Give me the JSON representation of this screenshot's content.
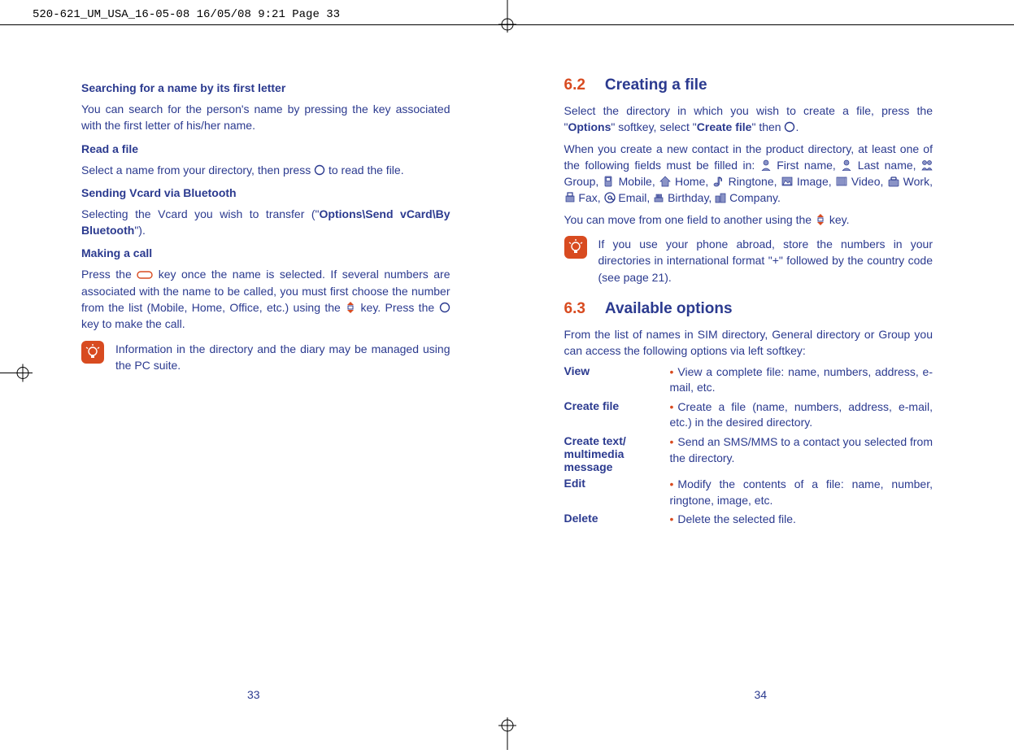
{
  "print_header": "520-621_UM_USA_16-05-08  16/05/08  9:21  Page 33",
  "left": {
    "h_search": "Searching for a name by its first letter",
    "p_search": "You can search for the person's name by pressing the key associated with the first letter of his/her name.",
    "h_read": "Read a file",
    "p_read_a": "Select a name from your directory, then press ",
    "p_read_b": " to read the file.",
    "h_send": "Sending Vcard via Bluetooth",
    "p_send_a": "Selecting the Vcard you wish to transfer (\"",
    "p_send_b": "Options\\Send vCard\\By Bluetooth",
    "p_send_c": "\").",
    "h_call": "Making a call",
    "p_call_a": "Press the ",
    "p_call_b": " key once the name is selected. If several numbers are associated with the name to be called, you must first choose the number from the list (Mobile, Home, Office, etc.) using the ",
    "p_call_c": " key. Press the ",
    "p_call_d": " key to make the call.",
    "tip": "Information in the directory and the diary may be managed using the PC suite.",
    "page_num": "33"
  },
  "right": {
    "s62_num": "6.2",
    "s62_title": "Creating a file",
    "p62_a": "Select the directory in which you wish to create a file, press the \"",
    "p62_b": "Options",
    "p62_c": "\" softkey, select \"",
    "p62_d": "Create file",
    "p62_e": "\" then ",
    "p62_f": ".",
    "p62_fields_a": "When you create a new contact in the product directory, at least one of the following fields must be filled in: ",
    "lbl_first": " First name, ",
    "lbl_last": " Last name, ",
    "lbl_group": " Group, ",
    "lbl_mobile": " Mobile, ",
    "lbl_home": " Home, ",
    "lbl_ringtone": " Ringtone, ",
    "lbl_image": " Image, ",
    "lbl_video": " Video, ",
    "lbl_work": " Work, ",
    "lbl_fax": " Fax, ",
    "lbl_email": " Email, ",
    "lbl_birthday": " Birthday, ",
    "lbl_company": " Company.",
    "p62_move_a": "You can move from one field to another using the ",
    "p62_move_b": " key.",
    "tip": "If you use your phone abroad, store the numbers in your directories in international format \"+\" followed by the country code (see page 21).",
    "s63_num": "6.3",
    "s63_title": "Available options",
    "p63_intro": "From the list of names in SIM directory, General directory or Group you can access the following options via left softkey:",
    "options": [
      {
        "k": "View",
        "v": "View a complete file: name, numbers, address, e-mail, etc."
      },
      {
        "k": "Create file",
        "v": "Create a file (name, numbers, address, e-mail, etc.) in the desired directory."
      },
      {
        "k": "Create text/ multimedia message",
        "v": "Send an SMS/MMS to a contact you selected from the directory."
      },
      {
        "k": "Edit",
        "v": "Modify the contents of a file: name, number, ringtone, image, etc."
      },
      {
        "k": "Delete",
        "v": "Delete the selected file."
      }
    ],
    "page_num": "34"
  }
}
